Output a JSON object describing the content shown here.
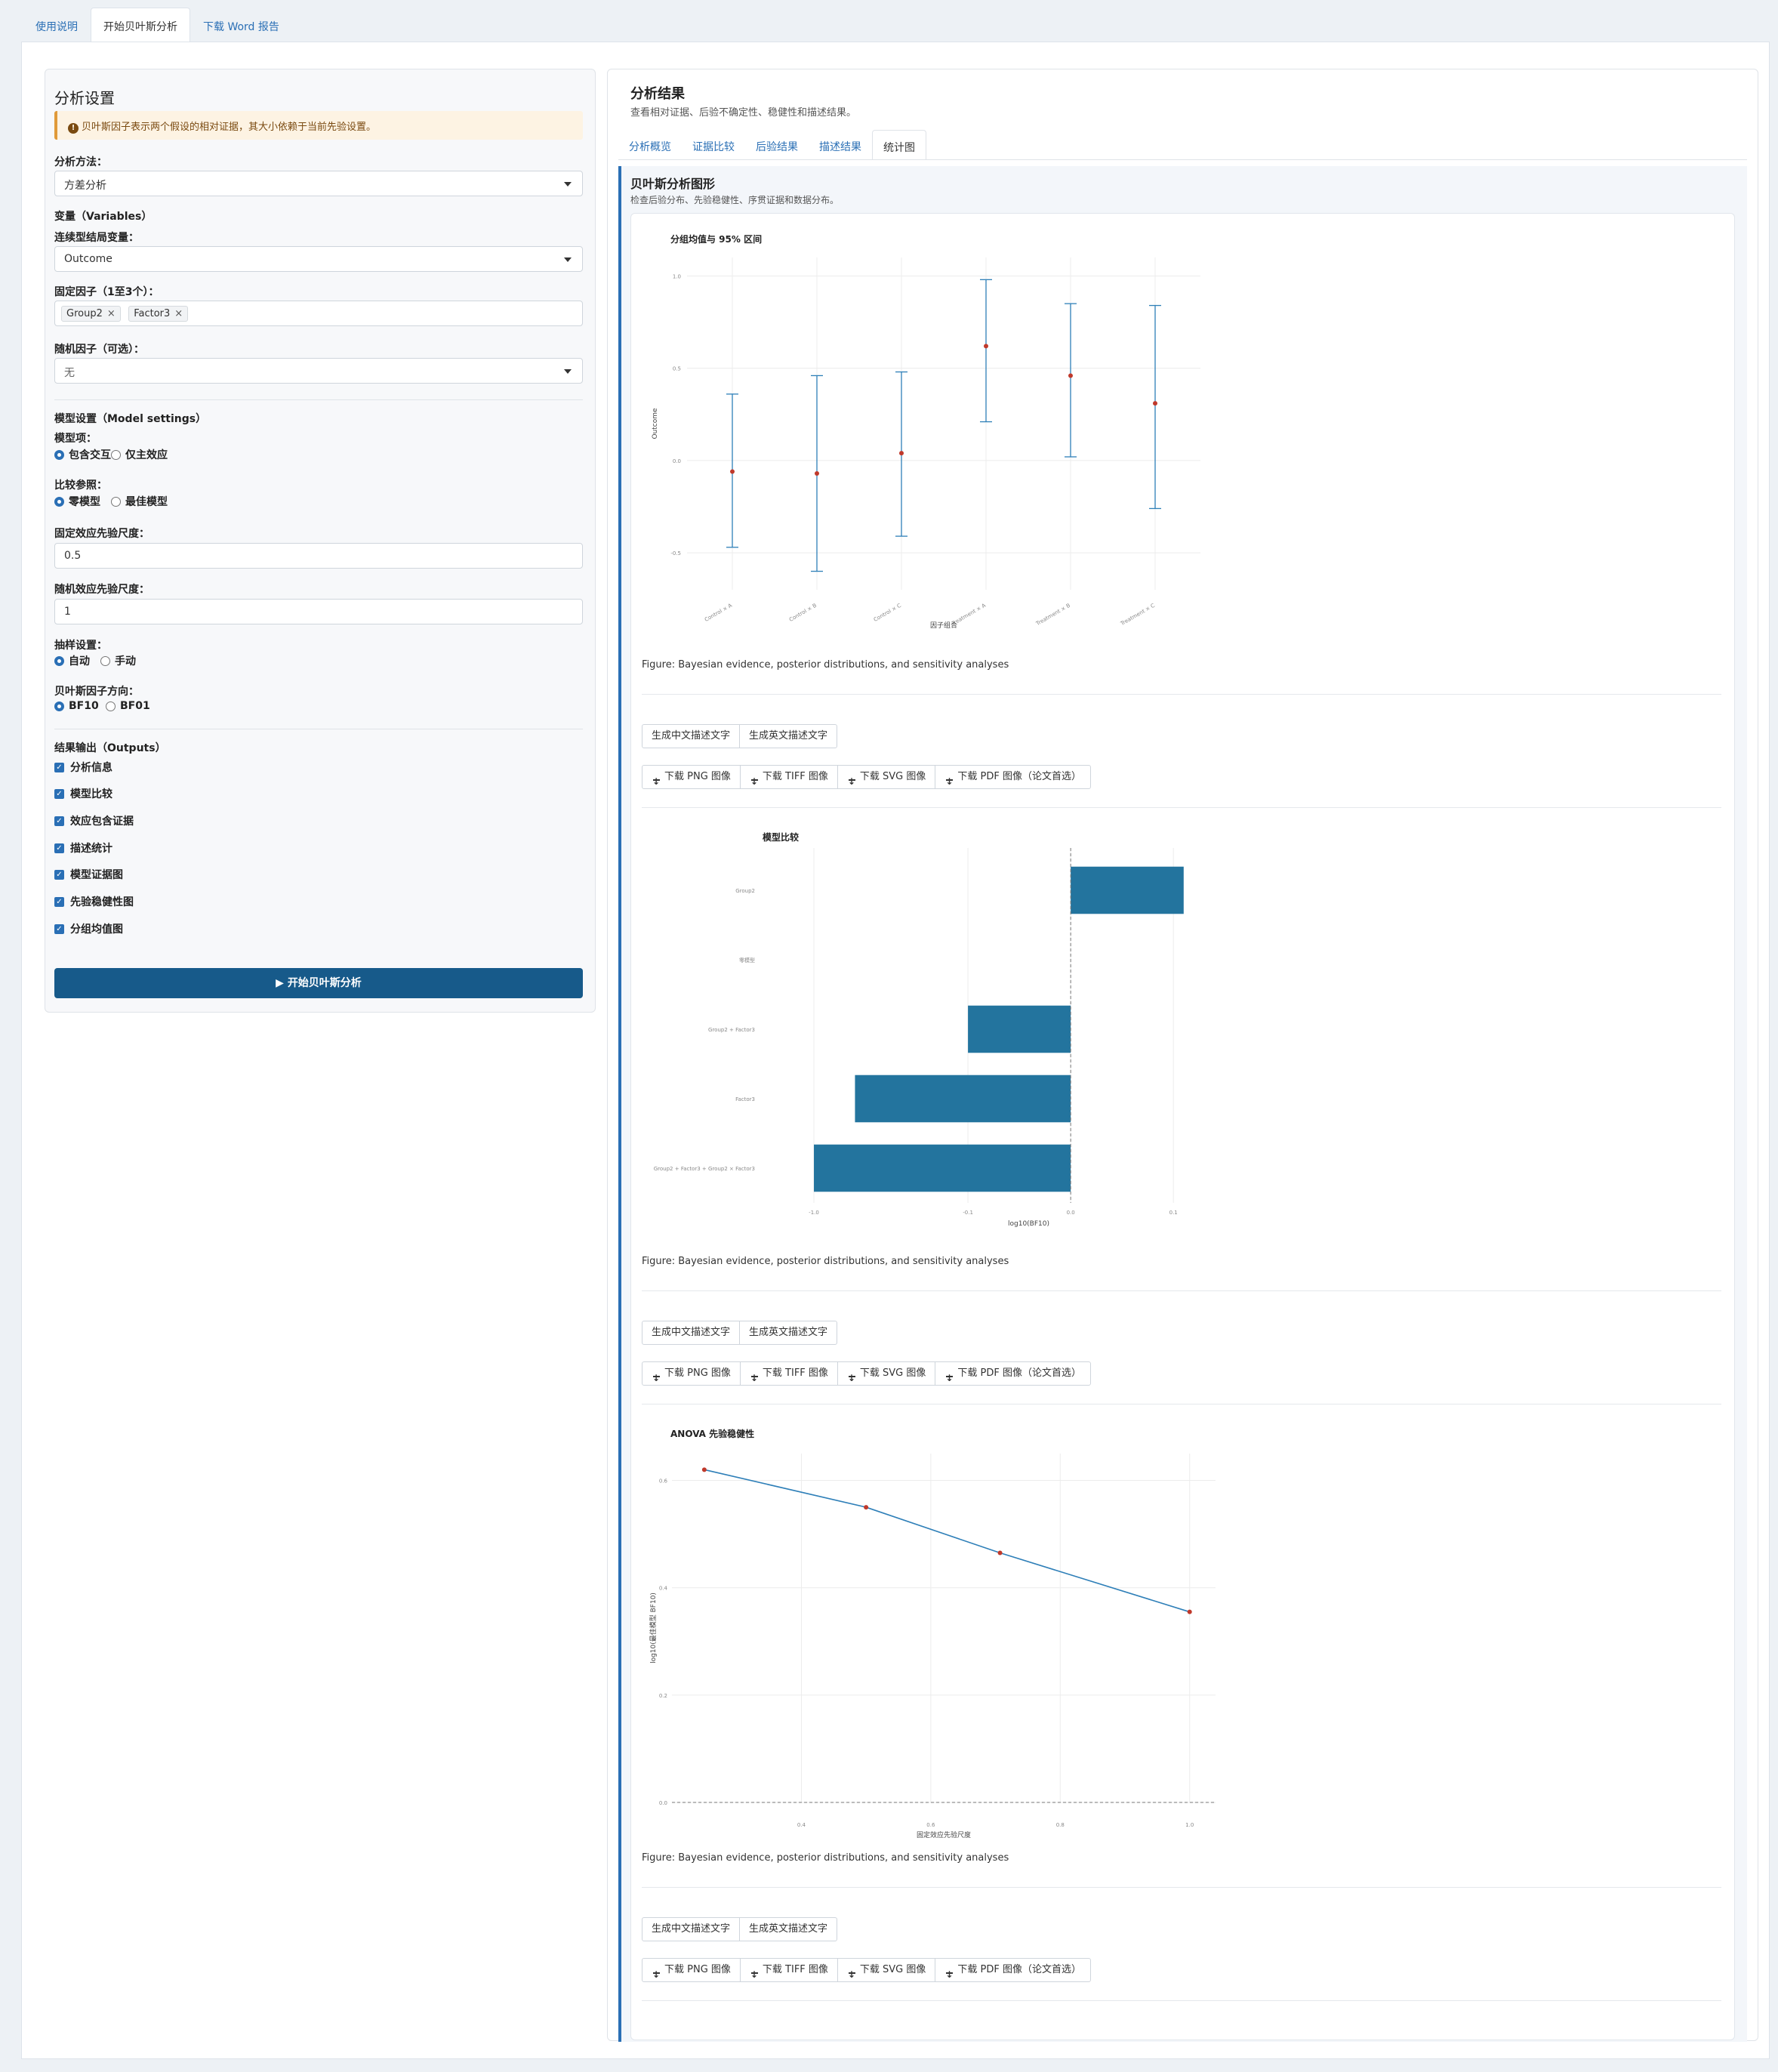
{
  "top_tabs": [
    "使用说明",
    "开始贝叶斯分析",
    "下载 Word 报告"
  ],
  "settings": {
    "title": "分析设置",
    "alert": "贝叶斯因子表示两个假设的相对证据，其大小依赖于当前先验设置。",
    "method_label": "分析方法：",
    "method_value": "方差分析",
    "variables_label": "变量（Variables）",
    "outcome_label": "连续型结局变量：",
    "outcome_value": "Outcome",
    "fixed_label": "固定因子（1至3个）：",
    "fixed_values": [
      "Group2",
      "Factor3"
    ],
    "random_label": "随机因子（可选）：",
    "random_value": "无",
    "model_label": "模型设置（Model settings）",
    "terms_label": "模型项：",
    "terms_options": [
      "包含交互",
      "仅主效应"
    ],
    "compare_label": "比较参照：",
    "compare_options": [
      "零模型",
      "最佳模型"
    ],
    "fixed_prior_label": "固定效应先验尺度：",
    "fixed_prior_value": "0.5",
    "random_prior_label": "随机效应先验尺度：",
    "random_prior_value": "1",
    "sampling_label": "抽样设置：",
    "sampling_options": [
      "自动",
      "手动"
    ],
    "bf_label": "贝叶斯因子方向：",
    "bf_options": [
      "BF10",
      "BF01"
    ],
    "outputs_label": "结果输出（Outputs）",
    "outputs": [
      "分析信息",
      "模型比较",
      "效应包含证据",
      "描述统计",
      "模型证据图",
      "先验稳健性图",
      "分组均值图"
    ],
    "run_button": "开始贝叶斯分析"
  },
  "results": {
    "title": "分析结果",
    "subtitle": "查看相对证据、后验不确定性、稳健性和描述结果。",
    "tabs": [
      "分析概览",
      "证据比较",
      "后验结果",
      "描述结果",
      "统计图"
    ],
    "section_title": "贝叶斯分析图形",
    "section_subtitle": "检查后验分布、先验稳健性、序贯证据和数据分布。",
    "caption": "Figure: Bayesian evidence, posterior distributions, and sensitivity analyses",
    "text_buttons": [
      "生成中文描述文字",
      "生成英文描述文字"
    ],
    "download_buttons": [
      "下载 PNG 图像",
      "下载 TIFF 图像",
      "下载 SVG 图像",
      "下载 PDF 图像（论文首选）"
    ]
  },
  "chart_data": [
    {
      "type": "scatter",
      "title": "分组均值与 95% 区间",
      "xlabel": "因子组合",
      "ylabel": "Outcome",
      "categories": [
        "Control × A",
        "Control × B",
        "Control × C",
        "Treatment × A",
        "Treatment × B",
        "Treatment × C"
      ],
      "means": [
        -0.06,
        -0.07,
        0.04,
        0.62,
        0.46,
        0.31
      ],
      "lower": [
        -0.47,
        -0.6,
        -0.41,
        0.21,
        0.02,
        -0.26
      ],
      "upper": [
        0.36,
        0.46,
        0.48,
        0.98,
        0.85,
        0.84
      ],
      "yticks": [
        "1.0",
        "0.5",
        "0.0",
        "-0.5"
      ],
      "ylim": [
        -0.7,
        1.1
      ]
    },
    {
      "type": "bar",
      "title": "模型比较",
      "xlabel": "log10(BF10)",
      "categories": [
        "Group2",
        "零模型",
        "Group2 + Factor3",
        "Factor3",
        "Group2 + Factor3 + Group2 × Factor3"
      ],
      "values": [
        0.11,
        0.0,
        -0.1,
        -0.21,
        -0.25
      ],
      "xticks": [
        "-1.0",
        "-0.1",
        "0.0",
        "0.1"
      ],
      "xlim": [
        -0.3,
        0.13
      ]
    },
    {
      "type": "line",
      "title": "ANOVA 先验稳健性",
      "xlabel": "固定效应先验尺度",
      "ylabel": "log10(最佳模型 BF10)",
      "x": [
        0.25,
        0.5,
        0.707,
        1.0
      ],
      "y": [
        0.62,
        0.55,
        0.465,
        0.355
      ],
      "xticks": [
        "0.4",
        "0.6",
        "0.8",
        "1.0"
      ],
      "yticks": [
        "0.6",
        "0.4",
        "0.2",
        "0.0"
      ],
      "xlim": [
        0.2,
        1.04
      ],
      "ylim": [
        0.0,
        0.65
      ]
    }
  ]
}
